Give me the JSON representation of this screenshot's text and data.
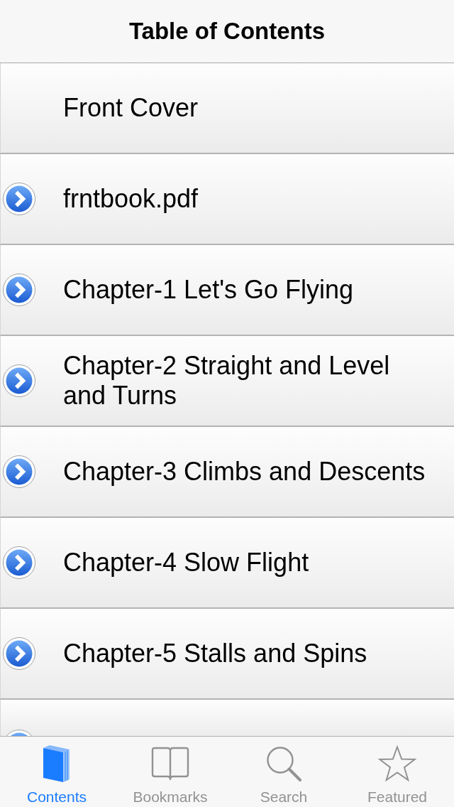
{
  "navbar": {
    "title": "Table of Contents"
  },
  "rows": [
    {
      "label": "Front Cover",
      "disclosure": false
    },
    {
      "label": "frntbook.pdf",
      "disclosure": true
    },
    {
      "label": "Chapter-1 Let's Go Flying",
      "disclosure": true
    },
    {
      "label": "Chapter-2 Straight and Level and Turns",
      "disclosure": true
    },
    {
      "label": "Chapter-3 Climbs and Descents",
      "disclosure": true
    },
    {
      "label": "Chapter-4 Slow Flight",
      "disclosure": true
    },
    {
      "label": "Chapter-5 Stalls and Spins",
      "disclosure": true
    },
    {
      "disclosure": true
    }
  ],
  "tab_bar": {
    "tabs": [
      {
        "label": "Contents",
        "selected": true
      },
      {
        "label": "Bookmarks",
        "selected": false
      },
      {
        "label": "Search",
        "selected": false
      },
      {
        "label": "Featured",
        "selected": false
      }
    ]
  }
}
